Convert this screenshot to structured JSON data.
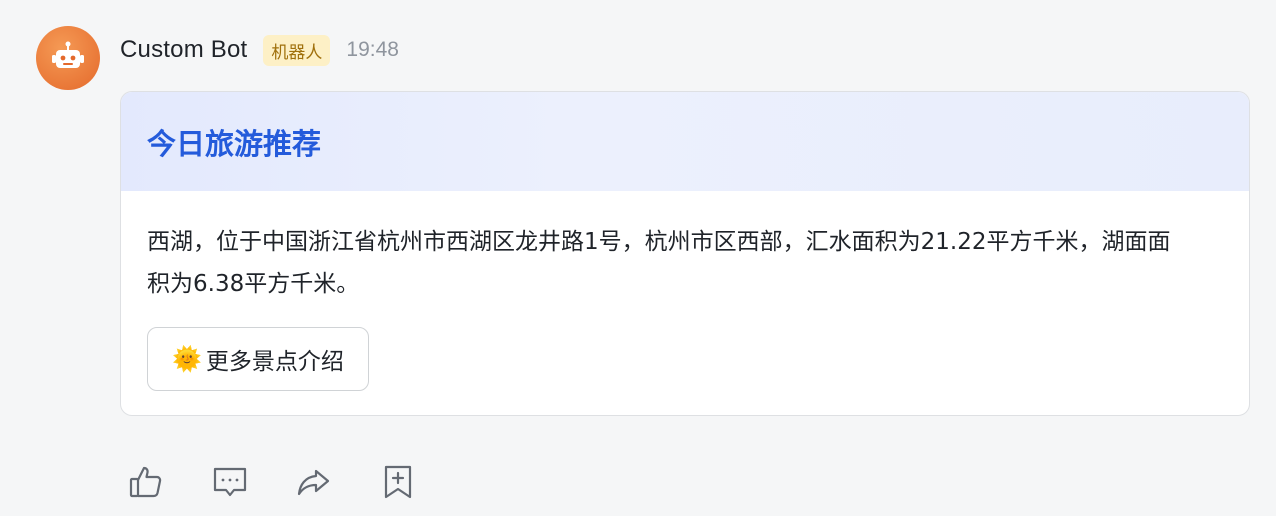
{
  "sender": {
    "name": "Custom Bot",
    "badge": "机器人",
    "time": "19:48",
    "avatar_icon": "robot-icon"
  },
  "card": {
    "title": "今日旅游推荐",
    "body": "西湖，位于中国浙江省杭州市西湖区龙井路1号，杭州市区西部，汇水面积为21.22平方千米，湖面面积为6.38平方千米。",
    "button": {
      "emoji": "🌞",
      "label": "更多景点介绍"
    },
    "header_color": "#e3e9fd",
    "title_color": "#245bdb"
  },
  "actions": [
    {
      "name": "like",
      "icon": "thumbs-up-icon"
    },
    {
      "name": "reply",
      "icon": "comment-icon"
    },
    {
      "name": "forward",
      "icon": "share-icon"
    },
    {
      "name": "bookmark",
      "icon": "bookmark-add-icon"
    }
  ],
  "colors": {
    "avatar": "#ec7a3a",
    "badge_bg": "#fdf0c6",
    "badge_text": "#a0700c"
  }
}
